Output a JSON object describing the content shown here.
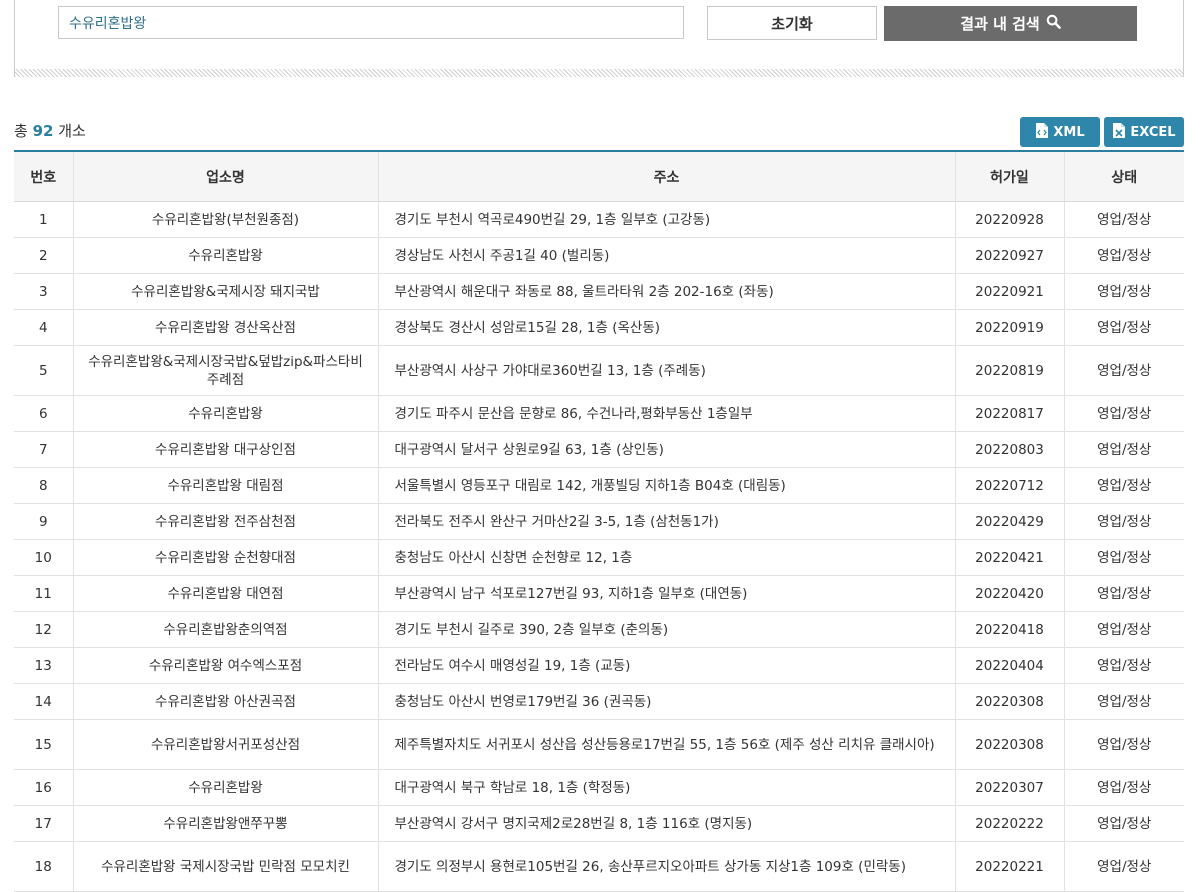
{
  "search": {
    "value": "수유리혼밥왕",
    "reset_label": "초기화",
    "search_label": "결과 내 검색"
  },
  "summary": {
    "prefix": "총",
    "count": "92",
    "suffix": "개소"
  },
  "downloads": {
    "xml_label": "XML",
    "excel_label": "EXCEL"
  },
  "table": {
    "headers": [
      "번호",
      "업소명",
      "주소",
      "허가일",
      "상태"
    ],
    "rows": [
      [
        "1",
        "수유리혼밥왕(부천원종점)",
        "경기도 부천시 역곡로490번길 29, 1층 일부호 (고강동)",
        "20220928",
        "영업/정상"
      ],
      [
        "2",
        "수유리혼밥왕",
        "경상남도 사천시 주공1길 40 (벌리동)",
        "20220927",
        "영업/정상"
      ],
      [
        "3",
        "수유리혼밥왕&국제시장 돼지국밥",
        "부산광역시 해운대구 좌동로 88, 울트라타워 2층 202-16호 (좌동)",
        "20220921",
        "영업/정상"
      ],
      [
        "4",
        "수유리혼밥왕 경산옥산점",
        "경상북도 경산시 성암로15길 28, 1층 (옥산동)",
        "20220919",
        "영업/정상"
      ],
      [
        "5",
        "수유리혼밥왕&국제시장국밥&덮밥zip&파스타비 주례점",
        "부산광역시 사상구 가야대로360번길 13, 1층 (주례동)",
        "20220819",
        "영업/정상"
      ],
      [
        "6",
        "수유리혼밥왕",
        "경기도 파주시 문산읍 문향로 86, 수건나라,평화부동산 1층일부",
        "20220817",
        "영업/정상"
      ],
      [
        "7",
        "수유리혼밥왕 대구상인점",
        "대구광역시 달서구 상원로9길 63, 1층 (상인동)",
        "20220803",
        "영업/정상"
      ],
      [
        "8",
        "수유리혼밥왕 대림점",
        "서울특별시 영등포구 대림로 142, 개풍빌딩 지하1층 B04호 (대림동)",
        "20220712",
        "영업/정상"
      ],
      [
        "9",
        "수유리혼밥왕 전주삼천점",
        "전라북도 전주시 완산구 거마산2길 3-5, 1층 (삼천동1가)",
        "20220429",
        "영업/정상"
      ],
      [
        "10",
        "수유리혼밥왕 순천향대점",
        "충청남도 아산시 신창면 순천향로 12, 1층",
        "20220421",
        "영업/정상"
      ],
      [
        "11",
        "수유리혼밥왕 대연점",
        "부산광역시 남구 석포로127번길 93, 지하1층 일부호 (대연동)",
        "20220420",
        "영업/정상"
      ],
      [
        "12",
        "수유리혼밥왕춘의역점",
        "경기도 부천시 길주로 390, 2층 일부호 (춘의동)",
        "20220418",
        "영업/정상"
      ],
      [
        "13",
        "수유리혼밥왕 여수엑스포점",
        "전라남도 여수시 매영성길 19, 1층 (교동)",
        "20220404",
        "영업/정상"
      ],
      [
        "14",
        "수유리혼밥왕 아산권곡점",
        "충청남도 아산시 번영로179번길 36 (권곡동)",
        "20220308",
        "영업/정상"
      ],
      [
        "15",
        "수유리혼밥왕서귀포성산점",
        "제주특별자치도 서귀포시 성산읍 성산등용로17번길 55, 1층 56호 (제주 성산 리치유 클래시아)",
        "20220308",
        "영업/정상"
      ],
      [
        "16",
        "수유리혼밥왕",
        "대구광역시 북구 학남로 18, 1층 (학정동)",
        "20220307",
        "영업/정상"
      ],
      [
        "17",
        "수유리혼밥왕앤쭈꾸뽕",
        "부산광역시 강서구 명지국제2로28번길 8, 1층 116호 (명지동)",
        "20220222",
        "영업/정상"
      ],
      [
        "18",
        "수유리혼밥왕 국제시장국밥 민락점 모모치킨",
        "경기도 의정부시 용현로105번길 26, 송산푸르지오아파트 상가동 지상1층 109호 (민락동)",
        "20220221",
        "영업/정상"
      ]
    ]
  },
  "colors": {
    "accent": "#2a7fa0",
    "button_blue": "#2e86ab",
    "search_button": "#6b6b6b"
  },
  "icons": {
    "search": "search-icon",
    "xml": "xml-file-icon",
    "excel": "excel-file-icon"
  }
}
